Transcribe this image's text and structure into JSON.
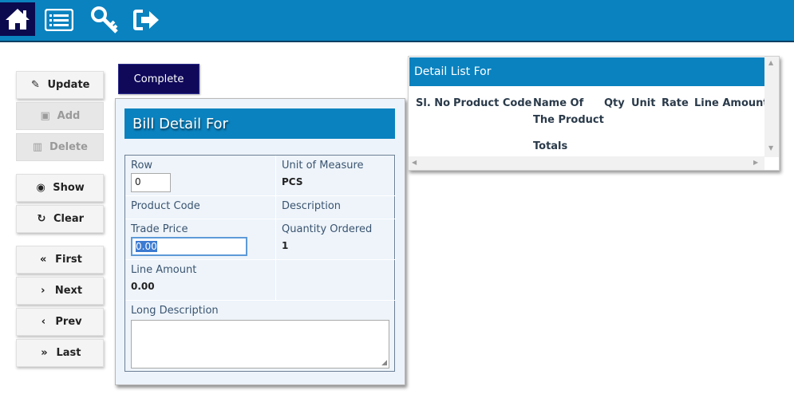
{
  "topbar": {
    "icons": [
      "home-icon",
      "list-icon",
      "key-icon",
      "sign-out-icon"
    ],
    "accent": "#0a82bf",
    "home_bg": "#0c0a4f"
  },
  "sidebar": {
    "update": "Update",
    "add": "Add",
    "delete": "Delete",
    "show": "Show",
    "clear": "Clear",
    "first": "First",
    "next": "Next",
    "prev": "Prev",
    "last": "Last"
  },
  "complete_label": "Complete",
  "bill": {
    "title": "Bill Detail For",
    "row_label": "Row",
    "row_value": "0",
    "uom_label": "Unit of Measure",
    "uom_value": "PCS",
    "product_code_label": "Product Code",
    "description_label": "Description",
    "trade_price_label": "Trade Price",
    "trade_price_value": "0.00",
    "qty_label": "Quantity Ordered",
    "qty_value": "1",
    "line_amount_label": "Line Amount",
    "line_amount_value": "0.00",
    "long_desc_label": "Long Description"
  },
  "list": {
    "title": "Detail List For",
    "columns": [
      "Sl. No",
      "Product Code",
      "Name Of The Product",
      "Qty",
      "Unit",
      "Rate",
      "Line Amount"
    ],
    "col_sl": "Sl. No",
    "col_code": "Product Code",
    "col_name_1": "Name Of",
    "col_name_2": "The Product",
    "col_qty": "Qty",
    "col_unit": "Unit",
    "col_rate": "Rate",
    "col_amount": "Line Amount",
    "totals_label": "Totals"
  }
}
